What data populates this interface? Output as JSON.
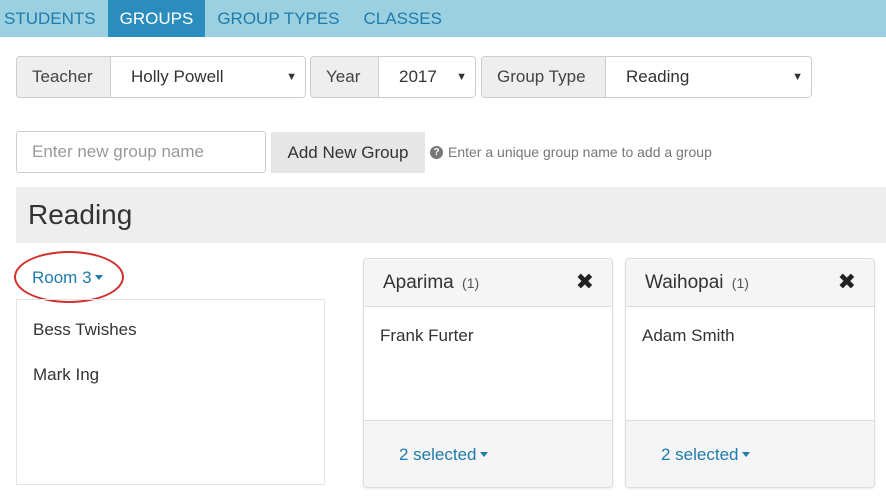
{
  "nav": {
    "tabs": [
      {
        "label": "STUDENTS"
      },
      {
        "label": "GROUPS",
        "active": true
      },
      {
        "label": "GROUP TYPES"
      },
      {
        "label": "CLASSES"
      }
    ]
  },
  "filters": {
    "teacher": {
      "label": "Teacher",
      "value": "Holly Powell"
    },
    "year": {
      "label": "Year",
      "value": "2017"
    },
    "group_type": {
      "label": "Group Type",
      "value": "Reading"
    }
  },
  "add_group": {
    "placeholder": "Enter new group name",
    "button_label": "Add New Group",
    "hint": "Enter a unique group name to add a group"
  },
  "section": {
    "title": "Reading"
  },
  "class_selector": {
    "label": "Room 3"
  },
  "unassigned_students": [
    "Bess Twishes",
    "Mark Ing"
  ],
  "groups": [
    {
      "name": "Aparima",
      "count": "(1)",
      "members": [
        "Frank Furter"
      ],
      "selection": "2 selected"
    },
    {
      "name": "Waihopai",
      "count": "(1)",
      "members": [
        "Adam Smith"
      ],
      "selection": "2 selected"
    }
  ],
  "colors": {
    "nav_bg": "#9ad0e0",
    "nav_active": "#2b8dbd",
    "link": "#1f7bab",
    "annotation": "#d0312d"
  },
  "icons": {
    "hint": "question-circle-icon",
    "remove": "close-icon",
    "dropdown": "caret-down-icon"
  }
}
